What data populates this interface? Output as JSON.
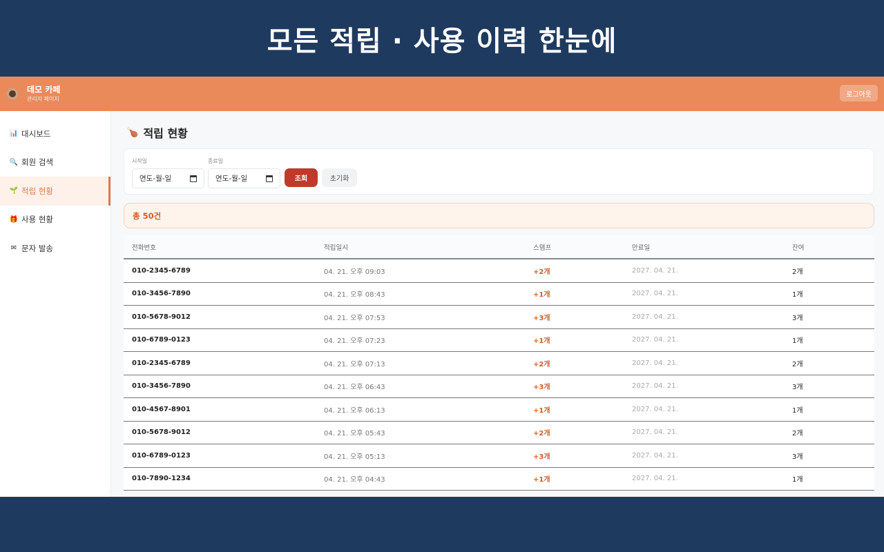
{
  "banner": {
    "title": "모든 적립 · 사용 이력 한눈에"
  },
  "appbar": {
    "brand_name": "데모 카페",
    "brand_sub": "관리자 페이지",
    "logout_label": "로그아웃"
  },
  "sidebar": {
    "items": [
      {
        "icon": "📊",
        "label": "대시보드"
      },
      {
        "icon": "🔍",
        "label": "회원 검색"
      },
      {
        "icon": "🌱",
        "label": "적립 현황"
      },
      {
        "icon": "🎁",
        "label": "사용 현황"
      },
      {
        "icon": "✉",
        "label": "문자 발송"
      }
    ],
    "active_index": 2
  },
  "page": {
    "icon": "🍗",
    "title": "적립 현황"
  },
  "filter": {
    "start_label": "시작일",
    "start_value": "연도-월-일",
    "end_label": "종료일",
    "end_value": "연도-월-일",
    "search_label": "조회",
    "reset_label": "초기화"
  },
  "summary": {
    "text": "총 50건"
  },
  "table": {
    "headers": [
      "전화번호",
      "적립일시",
      "스탬프",
      "만료일",
      "잔여"
    ],
    "rows": [
      [
        "010-2345-6789",
        "04. 21. 오후 09:03",
        "+2개",
        "2027. 04. 21.",
        "2개"
      ],
      [
        "010-3456-7890",
        "04. 21. 오후 08:43",
        "+1개",
        "2027. 04. 21.",
        "1개"
      ],
      [
        "010-5678-9012",
        "04. 21. 오후 07:53",
        "+3개",
        "2027. 04. 21.",
        "3개"
      ],
      [
        "010-6789-0123",
        "04. 21. 오후 07:23",
        "+1개",
        "2027. 04. 21.",
        "1개"
      ],
      [
        "010-2345-6789",
        "04. 21. 오후 07:13",
        "+2개",
        "2027. 04. 21.",
        "2개"
      ],
      [
        "010-3456-7890",
        "04. 21. 오후 06:43",
        "+3개",
        "2027. 04. 21.",
        "3개"
      ],
      [
        "010-4567-8901",
        "04. 21. 오후 06:13",
        "+1개",
        "2027. 04. 21.",
        "1개"
      ],
      [
        "010-5678-9012",
        "04. 21. 오후 05:43",
        "+2개",
        "2027. 04. 21.",
        "2개"
      ],
      [
        "010-6789-0123",
        "04. 21. 오후 05:13",
        "+3개",
        "2027. 04. 21.",
        "3개"
      ],
      [
        "010-7890-1234",
        "04. 21. 오후 04:43",
        "+1개",
        "2027. 04. 21.",
        "1개"
      ]
    ]
  },
  "colors": {
    "banner": "#1f3a5f",
    "appbar": "#ea8a5b",
    "accent": "#e07a48",
    "search_button": "#c0392b"
  }
}
